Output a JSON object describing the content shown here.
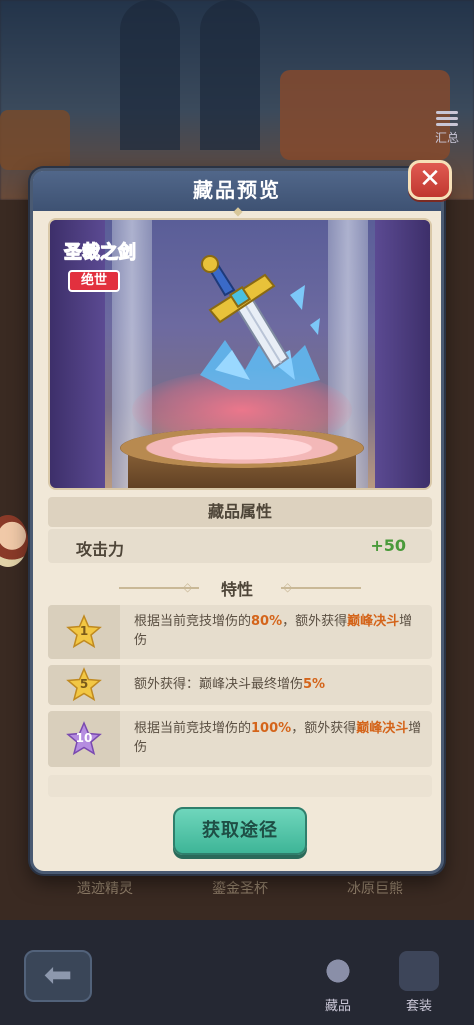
{
  "top_right": {
    "summary_label": "汇总"
  },
  "background_shelf": {
    "labels": [
      "遗迹精灵",
      "鎏金圣杯",
      "冰原巨熊"
    ]
  },
  "modal": {
    "title": "藏品预览",
    "close_icon": "close-icon",
    "item": {
      "name": "圣裁之剑",
      "rarity": "绝世",
      "rarity_color": "#e2303e"
    },
    "attributes": {
      "header": "藏品属性",
      "rows": [
        {
          "label": "攻击力",
          "value": "+50"
        }
      ]
    },
    "traits": {
      "header": "特性",
      "items": [
        {
          "level": "1",
          "star_color": "#f2c744",
          "text_a": "根据当前竞技增伤的",
          "hl1": "80%",
          "text_b": "，额外获得",
          "hl2": "巅峰决斗",
          "text_c": "增伤"
        },
        {
          "level": "5",
          "star_color": "#f2c744",
          "text_a": "额外获得：巅峰决斗最终增伤",
          "hl1": "5%",
          "text_b": "",
          "hl2": "",
          "text_c": ""
        },
        {
          "level": "10",
          "star_color": "#b58de0",
          "text_a": "根据当前竞技增伤的",
          "hl1": "100%",
          "text_b": "，额外获得",
          "hl2": "巅峰决斗",
          "text_c": "增伤"
        }
      ]
    },
    "obtain_button": "获取途径"
  },
  "bottom_nav": {
    "back_icon": "back-arrow-icon",
    "items": [
      {
        "label": "藏品"
      },
      {
        "label": "套装"
      }
    ]
  },
  "colors": {
    "accent_green": "#3eb597",
    "header_blue": "#4a6180",
    "highlight_orange": "#d4641a",
    "attr_value_green": "#4a9a3a"
  }
}
